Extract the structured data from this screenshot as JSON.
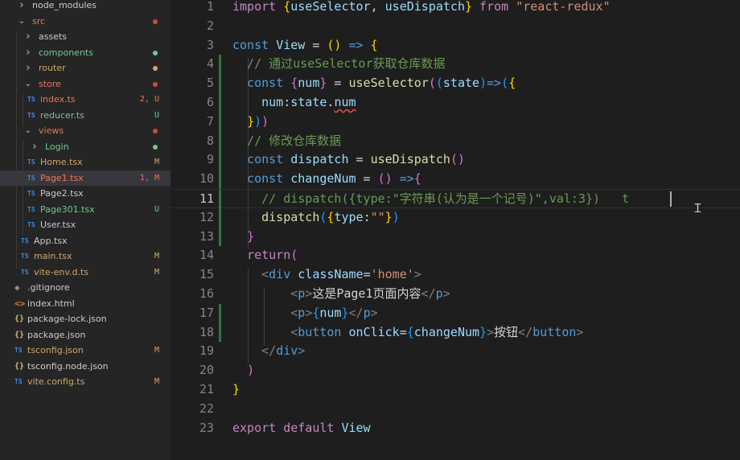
{
  "explorer": {
    "items": [
      {
        "name": "node_modules",
        "type": "folder",
        "open": false,
        "indent": 1,
        "status": "",
        "dot": ""
      },
      {
        "name": "src",
        "type": "folder",
        "open": true,
        "indent": 1,
        "status": "",
        "dot": "#c74e39"
      },
      {
        "name": "assets",
        "type": "folder",
        "open": false,
        "indent": 2,
        "status": "",
        "dot": ""
      },
      {
        "name": "components",
        "type": "folder",
        "open": false,
        "indent": 2,
        "status": "",
        "dot": "#73c991"
      },
      {
        "name": "router",
        "type": "folder",
        "open": false,
        "indent": 2,
        "status": "",
        "dot": "#d0a86a"
      },
      {
        "name": "store",
        "type": "folder",
        "open": true,
        "indent": 2,
        "status": "",
        "dot": "#c74e39"
      },
      {
        "name": "index.ts",
        "type": "ts",
        "indent": 3,
        "status": "2, U",
        "color": "#e8785a"
      },
      {
        "name": "reducer.ts",
        "type": "ts",
        "indent": 3,
        "status": "U",
        "color": "#73c991"
      },
      {
        "name": "views",
        "type": "folder",
        "open": true,
        "indent": 2,
        "status": "",
        "dot": "#c74e39"
      },
      {
        "name": "Login",
        "type": "folder",
        "open": false,
        "indent": 3,
        "status": "",
        "dot": "#73c991"
      },
      {
        "name": "Home.tsx",
        "type": "ts",
        "indent": 3,
        "status": "M",
        "color": "#d0a86a"
      },
      {
        "name": "Page1.tsx",
        "type": "ts",
        "indent": 3,
        "status": "1, M",
        "color": "#e8785a",
        "selected": true
      },
      {
        "name": "Page2.tsx",
        "type": "ts",
        "indent": 3,
        "status": "",
        "color": "#cccccc"
      },
      {
        "name": "Page301.tsx",
        "type": "ts",
        "indent": 3,
        "status": "U",
        "color": "#73c991"
      },
      {
        "name": "User.tsx",
        "type": "ts",
        "indent": 3,
        "status": "",
        "color": "#cccccc"
      },
      {
        "name": "App.tsx",
        "type": "ts",
        "indent": 2,
        "status": "",
        "color": "#cccccc"
      },
      {
        "name": "main.tsx",
        "type": "ts",
        "indent": 2,
        "status": "M",
        "color": "#d0a86a"
      },
      {
        "name": "vite-env.d.ts",
        "type": "ts",
        "indent": 2,
        "status": "M",
        "color": "#d0a86a"
      },
      {
        "name": ".gitignore",
        "type": "git",
        "indent": 1,
        "status": "",
        "color": "#cccccc"
      },
      {
        "name": "index.html",
        "type": "html",
        "indent": 1,
        "status": "",
        "color": "#cccccc"
      },
      {
        "name": "package-lock.json",
        "type": "json",
        "indent": 1,
        "status": "",
        "color": "#cccccc"
      },
      {
        "name": "package.json",
        "type": "json",
        "indent": 1,
        "status": "",
        "color": "#cccccc"
      },
      {
        "name": "tsconfig.json",
        "type": "tsconfig",
        "indent": 1,
        "status": "M",
        "color": "#d0a86a"
      },
      {
        "name": "tsconfig.node.json",
        "type": "json",
        "indent": 1,
        "status": "",
        "color": "#cccccc"
      },
      {
        "name": "vite.config.ts",
        "type": "ts",
        "indent": 1,
        "status": "M",
        "color": "#d0a86a"
      }
    ]
  },
  "editor": {
    "active_line": 11,
    "modified_lines": [
      4,
      5,
      6,
      7,
      8,
      9,
      10,
      11,
      12,
      13,
      17,
      18
    ],
    "lines": [
      {
        "n": "1",
        "segs": [
          [
            "import ",
            "ctl"
          ],
          [
            "{",
            "b1"
          ],
          [
            "useSelector",
            "var"
          ],
          [
            ", ",
            "txt"
          ],
          [
            "useDispatch",
            "var"
          ],
          [
            "}",
            "b1"
          ],
          [
            " from ",
            "ctl"
          ],
          [
            "\"react-redux\"",
            "str"
          ]
        ]
      },
      {
        "n": "2",
        "segs": []
      },
      {
        "n": "3",
        "segs": [
          [
            "const ",
            "kw"
          ],
          [
            "View",
            "var"
          ],
          [
            " = ",
            "txt"
          ],
          [
            "()",
            "b1"
          ],
          [
            " => ",
            "kw"
          ],
          [
            "{",
            "b1"
          ]
        ]
      },
      {
        "n": "4",
        "segs": [
          [
            "  // 通过useSelector获取仓库数据",
            "cm"
          ]
        ]
      },
      {
        "n": "5",
        "segs": [
          [
            "  const ",
            "kw"
          ],
          [
            "{",
            "b2"
          ],
          [
            "num",
            "var"
          ],
          [
            "}",
            "b2"
          ],
          [
            " = ",
            "txt"
          ],
          [
            "useSelector",
            "fn"
          ],
          [
            "(",
            "b2"
          ],
          [
            "(",
            "b3"
          ],
          [
            "state",
            "var"
          ],
          [
            ")",
            "b3"
          ],
          [
            "=>",
            "kw"
          ],
          [
            "(",
            "b3"
          ],
          [
            "{",
            "b1"
          ]
        ]
      },
      {
        "n": "6",
        "segs": [
          [
            "    num",
            "var"
          ],
          [
            ":",
            "txt"
          ],
          [
            "state",
            "var"
          ],
          [
            ".",
            "txt"
          ],
          [
            "num",
            "var squig"
          ]
        ]
      },
      {
        "n": "7",
        "segs": [
          [
            "  ",
            "txt"
          ],
          [
            "}",
            "b1"
          ],
          [
            ")",
            "b3"
          ],
          [
            ")",
            "b2"
          ]
        ]
      },
      {
        "n": "8",
        "segs": [
          [
            "  // 修改仓库数据",
            "cm"
          ]
        ]
      },
      {
        "n": "9",
        "segs": [
          [
            "  const ",
            "kw"
          ],
          [
            "dispatch",
            "var"
          ],
          [
            " = ",
            "txt"
          ],
          [
            "useDispatch",
            "fn"
          ],
          [
            "()",
            "b2"
          ]
        ]
      },
      {
        "n": "10",
        "segs": [
          [
            "  const ",
            "kw"
          ],
          [
            "changeNum",
            "var"
          ],
          [
            " = ",
            "txt"
          ],
          [
            "()",
            "b2"
          ],
          [
            " =>",
            "kw"
          ],
          [
            "{",
            "b2"
          ]
        ]
      },
      {
        "n": "11",
        "segs": [
          [
            "    // dispatch({type:\"字符串(认为是一个记号)\",val:3})   t",
            "cm"
          ]
        ]
      },
      {
        "n": "12",
        "segs": [
          [
            "    dispatch",
            "fn"
          ],
          [
            "(",
            "b3"
          ],
          [
            "{",
            "b1"
          ],
          [
            "type",
            "var"
          ],
          [
            ":",
            "txt"
          ],
          [
            "\"\"",
            "str"
          ],
          [
            "}",
            "b1"
          ],
          [
            ")",
            "b3"
          ]
        ]
      },
      {
        "n": "13",
        "segs": [
          [
            "  ",
            "txt"
          ],
          [
            "}",
            "b2"
          ]
        ]
      },
      {
        "n": "14",
        "segs": [
          [
            "  return",
            "ctl"
          ],
          [
            "(",
            "b2"
          ]
        ]
      },
      {
        "n": "15",
        "segs": [
          [
            "    ",
            "txt"
          ],
          [
            "<",
            "tagp"
          ],
          [
            "div",
            "tag"
          ],
          [
            " className",
            "attr"
          ],
          [
            "=",
            "txt"
          ],
          [
            "'home'",
            "str"
          ],
          [
            ">",
            "tagp"
          ]
        ]
      },
      {
        "n": "16",
        "segs": [
          [
            "        ",
            "txt"
          ],
          [
            "<",
            "tagp"
          ],
          [
            "p",
            "tag"
          ],
          [
            ">",
            "tagp"
          ],
          [
            "这是Page1页面内容",
            "txt"
          ],
          [
            "</",
            "tagp"
          ],
          [
            "p",
            "tag"
          ],
          [
            ">",
            "tagp"
          ]
        ]
      },
      {
        "n": "17",
        "segs": [
          [
            "        ",
            "txt"
          ],
          [
            "<",
            "tagp"
          ],
          [
            "p",
            "tag"
          ],
          [
            ">",
            "tagp"
          ],
          [
            "{",
            "b3"
          ],
          [
            "num",
            "var"
          ],
          [
            "}",
            "b3"
          ],
          [
            "</",
            "tagp"
          ],
          [
            "p",
            "tag"
          ],
          [
            ">",
            "tagp"
          ]
        ]
      },
      {
        "n": "18",
        "segs": [
          [
            "        ",
            "txt"
          ],
          [
            "<",
            "tagp"
          ],
          [
            "button",
            "tag"
          ],
          [
            " onClick",
            "attr"
          ],
          [
            "=",
            "txt"
          ],
          [
            "{",
            "b3"
          ],
          [
            "changeNum",
            "var"
          ],
          [
            "}",
            "b3"
          ],
          [
            ">",
            "tagp"
          ],
          [
            "按钮",
            "txt"
          ],
          [
            "</",
            "tagp"
          ],
          [
            "button",
            "tag"
          ],
          [
            ">",
            "tagp"
          ]
        ]
      },
      {
        "n": "19",
        "segs": [
          [
            "    ",
            "txt"
          ],
          [
            "</",
            "tagp"
          ],
          [
            "div",
            "tag"
          ],
          [
            ">",
            "tagp"
          ]
        ]
      },
      {
        "n": "20",
        "segs": [
          [
            "  ",
            "txt"
          ],
          [
            ")",
            "b2"
          ]
        ]
      },
      {
        "n": "21",
        "segs": [
          [
            "}",
            "b1"
          ]
        ]
      },
      {
        "n": "22",
        "segs": []
      },
      {
        "n": "23",
        "segs": [
          [
            "export ",
            "ctl"
          ],
          [
            "default ",
            "ctl"
          ],
          [
            "View",
            "var"
          ]
        ]
      }
    ]
  }
}
